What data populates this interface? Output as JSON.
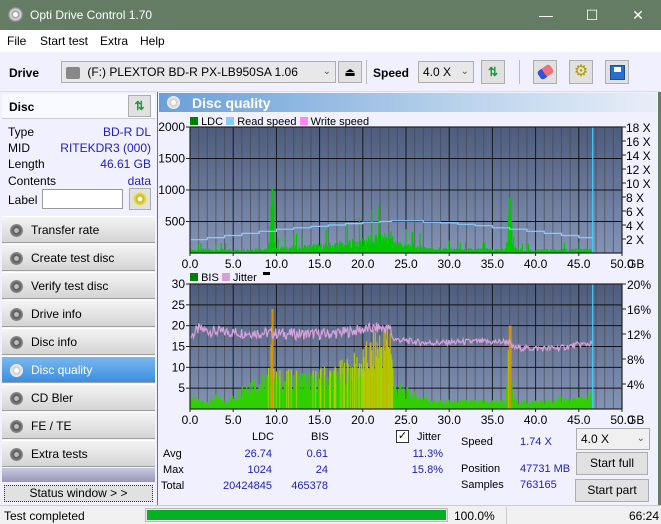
{
  "window": {
    "title": "Opti Drive Control 1.70",
    "minimize": "—",
    "maximize": "☐",
    "close": "✕"
  },
  "menu": [
    {
      "label": "File",
      "accel": "F"
    },
    {
      "label": "Start test",
      "accel": "S"
    },
    {
      "label": "Extra",
      "accel": "x"
    },
    {
      "label": "Help",
      "accel": "H"
    }
  ],
  "toolbar": {
    "drive_label": "Drive",
    "drive_value": "(F:)  PLEXTOR BD-R  PX-LB950SA 1.06",
    "speed_label": "Speed",
    "speed_value": "4.0 X",
    "icons": [
      "eject-icon",
      "refresh-icon",
      "eraser-icon",
      "settings-gears-icon",
      "save-icon"
    ]
  },
  "disc": {
    "header": "Disc",
    "fields": [
      {
        "label": "Type",
        "value": "BD-R DL"
      },
      {
        "label": "MID",
        "value": "RITEKDR3 (000)"
      },
      {
        "label": "Length",
        "value": "46.61 GB"
      },
      {
        "label": "Contents",
        "value": "data"
      }
    ],
    "label_label": "Label",
    "label_value": ""
  },
  "nav": [
    {
      "label": "Transfer rate",
      "active": false
    },
    {
      "label": "Create test disc",
      "active": false
    },
    {
      "label": "Verify test disc",
      "active": false
    },
    {
      "label": "Drive info",
      "active": false
    },
    {
      "label": "Disc info",
      "active": false
    },
    {
      "label": "Disc quality",
      "active": true
    },
    {
      "label": "CD Bler",
      "active": false
    },
    {
      "label": "FE / TE",
      "active": false
    },
    {
      "label": "Extra tests",
      "active": false
    }
  ],
  "status_window_button": "Status window > >",
  "panel_title": "Disc quality",
  "chart_data": [
    {
      "type": "bar",
      "title": "LDC",
      "legend": [
        {
          "name": "LDC",
          "color": "#008000"
        },
        {
          "name": "Read speed",
          "color": "#88ccff"
        },
        {
          "name": "Write speed",
          "color": "#ff88ee"
        }
      ],
      "legend_position": "top-left",
      "xlabel": "GB",
      "xlim": [
        0,
        50
      ],
      "xticks": [
        "0.0",
        "5.0",
        "10.0",
        "15.0",
        "20.0",
        "25.0",
        "30.0",
        "35.0",
        "40.0",
        "45.0",
        "50.0"
      ],
      "ylim": [
        0,
        2000
      ],
      "yticks": [
        "500",
        "1000",
        "1500",
        "2000"
      ],
      "y2lim": [
        0,
        18
      ],
      "y2ticks": [
        "2 X",
        "4 X",
        "6 X",
        "8 X",
        "10 X",
        "12 X",
        "14 X",
        "16 X",
        "18 X"
      ],
      "grid": true,
      "end_marker_gb": 46.61,
      "ldc_profile": [
        [
          0.0,
          60
        ],
        [
          1.0,
          50
        ],
        [
          2.0,
          70
        ],
        [
          3.0,
          50
        ],
        [
          4.0,
          60
        ],
        [
          5.0,
          50
        ],
        [
          6.0,
          60
        ],
        [
          7.0,
          70
        ],
        [
          8.0,
          80
        ],
        [
          9.0,
          80
        ],
        [
          9.5,
          1024
        ],
        [
          9.8,
          90
        ],
        [
          10.5,
          90
        ],
        [
          11.5,
          100
        ],
        [
          12.5,
          110
        ],
        [
          13.5,
          110
        ],
        [
          14.5,
          120
        ],
        [
          15.5,
          130
        ],
        [
          16.5,
          140
        ],
        [
          17.5,
          160
        ],
        [
          18.5,
          180
        ],
        [
          19.5,
          200
        ],
        [
          20.5,
          230
        ],
        [
          21.5,
          260
        ],
        [
          22.5,
          290
        ],
        [
          23.2,
          300
        ],
        [
          23.6,
          200
        ],
        [
          24.5,
          150
        ],
        [
          25.5,
          120
        ],
        [
          26.5,
          110
        ],
        [
          27.5,
          90
        ],
        [
          28.5,
          80
        ],
        [
          29.5,
          70
        ],
        [
          30.5,
          70
        ],
        [
          31.5,
          60
        ],
        [
          32.5,
          60
        ],
        [
          33.5,
          60
        ],
        [
          34.5,
          60
        ],
        [
          35.5,
          60
        ],
        [
          36.5,
          70
        ],
        [
          37.0,
          880
        ],
        [
          37.3,
          100
        ],
        [
          38.0,
          60
        ],
        [
          39.0,
          50
        ],
        [
          40.0,
          50
        ],
        [
          41.0,
          60
        ],
        [
          42.0,
          50
        ],
        [
          43.0,
          60
        ],
        [
          44.0,
          60
        ],
        [
          45.0,
          60
        ],
        [
          46.0,
          70
        ],
        [
          46.6,
          80
        ]
      ],
      "read_speed_x": [
        [
          0.0,
          1.9
        ],
        [
          2.0,
          2.2
        ],
        [
          4.0,
          2.5
        ],
        [
          6.0,
          2.8
        ],
        [
          8.0,
          3.1
        ],
        [
          10.0,
          3.4
        ],
        [
          12.0,
          3.6
        ],
        [
          14.0,
          3.8
        ],
        [
          16.0,
          4.0
        ],
        [
          18.0,
          4.2
        ],
        [
          20.0,
          4.4
        ],
        [
          22.0,
          4.5
        ],
        [
          23.3,
          4.6
        ],
        [
          25.0,
          4.6
        ],
        [
          27.0,
          4.4
        ],
        [
          29.0,
          4.3
        ],
        [
          31.0,
          4.1
        ],
        [
          33.0,
          3.9
        ],
        [
          35.0,
          3.6
        ],
        [
          37.0,
          3.4
        ],
        [
          39.0,
          3.1
        ],
        [
          41.0,
          2.8
        ],
        [
          43.0,
          2.5
        ],
        [
          45.0,
          2.2
        ],
        [
          46.6,
          2.0
        ]
      ]
    },
    {
      "type": "bar",
      "title": "BIS / Jitter",
      "legend": [
        {
          "name": "BIS",
          "color": "#008000"
        },
        {
          "name": "Jitter",
          "color": "#d8a0d8"
        }
      ],
      "legend_position": "top-left",
      "xlabel": "GB",
      "xlim": [
        0,
        50
      ],
      "xticks": [
        "0.0",
        "5.0",
        "10.0",
        "15.0",
        "20.0",
        "25.0",
        "30.0",
        "35.0",
        "40.0",
        "45.0",
        "50.0"
      ],
      "ylim": [
        0,
        30
      ],
      "yticks": [
        "5",
        "10",
        "15",
        "20",
        "25",
        "30"
      ],
      "y2lim": [
        0,
        20
      ],
      "y2ticks": [
        "4%",
        "8%",
        "12%",
        "16%",
        "20%"
      ],
      "grid": true,
      "end_marker_gb": 46.61,
      "bis_profile": [
        [
          0.0,
          3
        ],
        [
          1.0,
          2
        ],
        [
          2.0,
          2
        ],
        [
          3.0,
          3
        ],
        [
          4.0,
          2
        ],
        [
          5.0,
          3
        ],
        [
          5.5,
          4
        ],
        [
          6.0,
          6
        ],
        [
          7.0,
          7
        ],
        [
          8.0,
          7
        ],
        [
          9.0,
          8
        ],
        [
          9.5,
          24
        ],
        [
          9.8,
          8
        ],
        [
          10.5,
          8
        ],
        [
          11.5,
          8
        ],
        [
          12.5,
          8
        ],
        [
          13.5,
          8
        ],
        [
          14.5,
          8
        ],
        [
          15.5,
          9
        ],
        [
          16.5,
          9
        ],
        [
          17.5,
          10
        ],
        [
          18.5,
          11
        ],
        [
          19.5,
          12
        ],
        [
          20.5,
          14
        ],
        [
          21.5,
          17
        ],
        [
          22.5,
          18
        ],
        [
          23.2,
          20
        ],
        [
          23.5,
          6
        ],
        [
          24.5,
          5
        ],
        [
          25.5,
          4
        ],
        [
          26.5,
          3
        ],
        [
          27.5,
          3
        ],
        [
          28.5,
          2
        ],
        [
          29.5,
          2
        ],
        [
          30.5,
          2
        ],
        [
          31.5,
          2
        ],
        [
          32.5,
          2
        ],
        [
          33.5,
          2
        ],
        [
          34.5,
          2
        ],
        [
          35.5,
          2
        ],
        [
          36.5,
          2
        ],
        [
          37.0,
          20
        ],
        [
          37.3,
          3
        ],
        [
          38.0,
          2
        ],
        [
          39.0,
          2
        ],
        [
          40.0,
          2
        ],
        [
          41.0,
          2
        ],
        [
          42.0,
          2
        ],
        [
          43.0,
          3
        ],
        [
          44.0,
          2
        ],
        [
          45.0,
          3
        ],
        [
          46.0,
          3
        ],
        [
          46.6,
          4
        ]
      ],
      "jitter_pct": [
        [
          0.0,
          11.5
        ],
        [
          1.0,
          12.8
        ],
        [
          2.0,
          12.5
        ],
        [
          4.0,
          12.3
        ],
        [
          6.0,
          12.2
        ],
        [
          8.0,
          12.2
        ],
        [
          10.0,
          12.1
        ],
        [
          12.0,
          12.0
        ],
        [
          14.0,
          12.0
        ],
        [
          16.0,
          12.0
        ],
        [
          18.0,
          12.3
        ],
        [
          20.0,
          12.7
        ],
        [
          22.0,
          13.0
        ],
        [
          23.2,
          12.8
        ],
        [
          23.5,
          11.2
        ],
        [
          25.0,
          10.9
        ],
        [
          27.0,
          10.6
        ],
        [
          29.0,
          10.6
        ],
        [
          31.0,
          10.7
        ],
        [
          33.0,
          10.8
        ],
        [
          35.0,
          10.7
        ],
        [
          37.0,
          10.8
        ],
        [
          37.2,
          9.9
        ],
        [
          39.0,
          9.7
        ],
        [
          41.0,
          9.7
        ],
        [
          43.0,
          9.8
        ],
        [
          45.0,
          10.3
        ],
        [
          46.6,
          10.5
        ]
      ]
    }
  ],
  "stats": {
    "col_ldc": "LDC",
    "col_bis": "BIS",
    "jitter_label": "Jitter",
    "jitter_checked": true,
    "rows": [
      {
        "label": "Avg",
        "ldc": "26.74",
        "bis": "0.61",
        "jitter": "11.3%"
      },
      {
        "label": "Max",
        "ldc": "1024",
        "bis": "24",
        "jitter": "15.8%"
      },
      {
        "label": "Total",
        "ldc": "20424845",
        "bis": "465378",
        "jitter": ""
      }
    ],
    "speed_label": "Speed",
    "speed_value": "1.74 X",
    "position_label": "Position",
    "position_value": "47731 MB",
    "samples_label": "Samples",
    "samples_value": "763165",
    "speed_select": "4.0 X",
    "start_full": "Start full",
    "start_part": "Start part"
  },
  "statusbar": {
    "text": "Test completed",
    "progress_pct": 100.0,
    "progress_text": "100.0%",
    "time": "66:24"
  }
}
